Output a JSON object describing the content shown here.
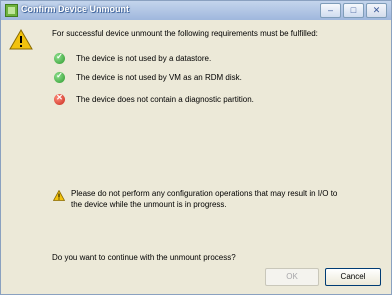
{
  "window": {
    "title": "Confirm Device Unmount"
  },
  "main": {
    "intro": "For successful device unmount the following requirements must be fulfilled:",
    "requirements": [
      {
        "status": "ok",
        "icon": "check-circle-icon",
        "text": "The device is not used by a datastore."
      },
      {
        "status": "ok",
        "icon": "check-circle-icon",
        "text": "The device is not used by VM as an RDM disk."
      },
      {
        "status": "error",
        "icon": "error-circle-icon",
        "text": "The device does not contain a diagnostic partition."
      }
    ],
    "warning_line1": "Please do not perform any configuration operations that may result in I/O to",
    "warning_line2": "the device while the unmount is in progress.",
    "question": "Do you want to continue with the unmount process?"
  },
  "buttons": {
    "ok": "OK",
    "cancel": "Cancel"
  },
  "colors": {
    "titlebar": "#9fb7dd",
    "dialog_bg": "#ece9d8",
    "ok_icon": "#2d9a2d",
    "error_icon": "#c72b1e",
    "warning_icon": "#f2c20e"
  }
}
